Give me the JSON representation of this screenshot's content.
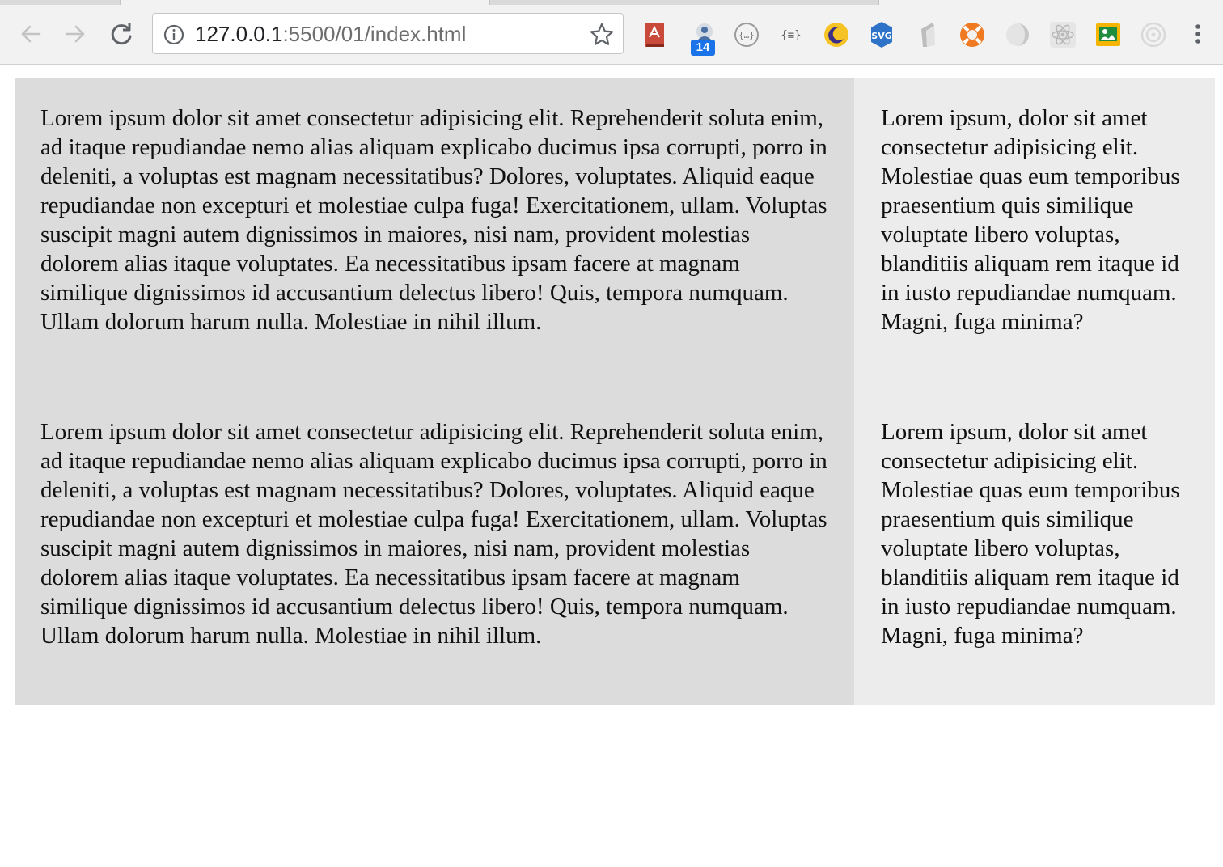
{
  "browser": {
    "url_host": "127.0.0.1",
    "url_rest": ":5500/01/index.html",
    "extension_badge": "14",
    "extensions": [
      "pdf-extension-icon",
      "notification-extension-icon",
      "json-viewer-icon",
      "code-formatter-icon",
      "moon-icon",
      "svg-extension-icon",
      "pen-extension-icon",
      "lifebuoy-icon",
      "half-circle-extension-icon",
      "react-devtools-icon",
      "slides-extension-icon",
      "target-extension-icon"
    ]
  },
  "content": {
    "main_paragraphs": [
      "Lorem ipsum dolor sit amet consectetur adipisicing elit. Reprehenderit soluta enim, ad itaque repudiandae nemo alias aliquam explicabo ducimus ipsa corrupti, porro in deleniti, a voluptas est magnam necessitatibus? Dolores, voluptates. Aliquid eaque repudiandae non excepturi et molestiae culpa fuga! Exercitationem, ullam. Voluptas suscipit magni autem dignissimos in maiores, nisi nam, provident molestias dolorem alias itaque voluptates. Ea necessitatibus ipsam facere at magnam similique dignissimos id accusantium delectus libero! Quis, tempora numquam. Ullam dolorum harum nulla. Molestiae in nihil illum.",
      "Lorem ipsum dolor sit amet consectetur adipisicing elit. Reprehenderit soluta enim, ad itaque repudiandae nemo alias aliquam explicabo ducimus ipsa corrupti, porro in deleniti, a voluptas est magnam necessitatibus? Dolores, voluptates. Aliquid eaque repudiandae non excepturi et molestiae culpa fuga! Exercitationem, ullam. Voluptas suscipit magni autem dignissimos in maiores, nisi nam, provident molestias dolorem alias itaque voluptates. Ea necessitatibus ipsam facere at magnam similique dignissimos id accusantium delectus libero! Quis, tempora numquam. Ullam dolorum harum nulla. Molestiae in nihil illum."
    ],
    "side_paragraphs": [
      "Lorem ipsum, dolor sit amet consectetur adipisicing elit. Molestiae quas eum temporibus praesentium quis similique voluptate libero voluptas, blanditiis aliquam rem itaque id in iusto repudiandae numquam. Magni, fuga minima?",
      "Lorem ipsum, dolor sit amet consectetur adipisicing elit. Molestiae quas eum temporibus praesentium quis similique voluptate libero voluptas, blanditiis aliquam rem itaque id in iusto repudiandae numquam. Magni, fuga minima?"
    ]
  },
  "colors": {
    "main_column_bg": "#dcdcdc",
    "side_column_bg": "#ececec",
    "badge_bg": "#1a73e8"
  }
}
